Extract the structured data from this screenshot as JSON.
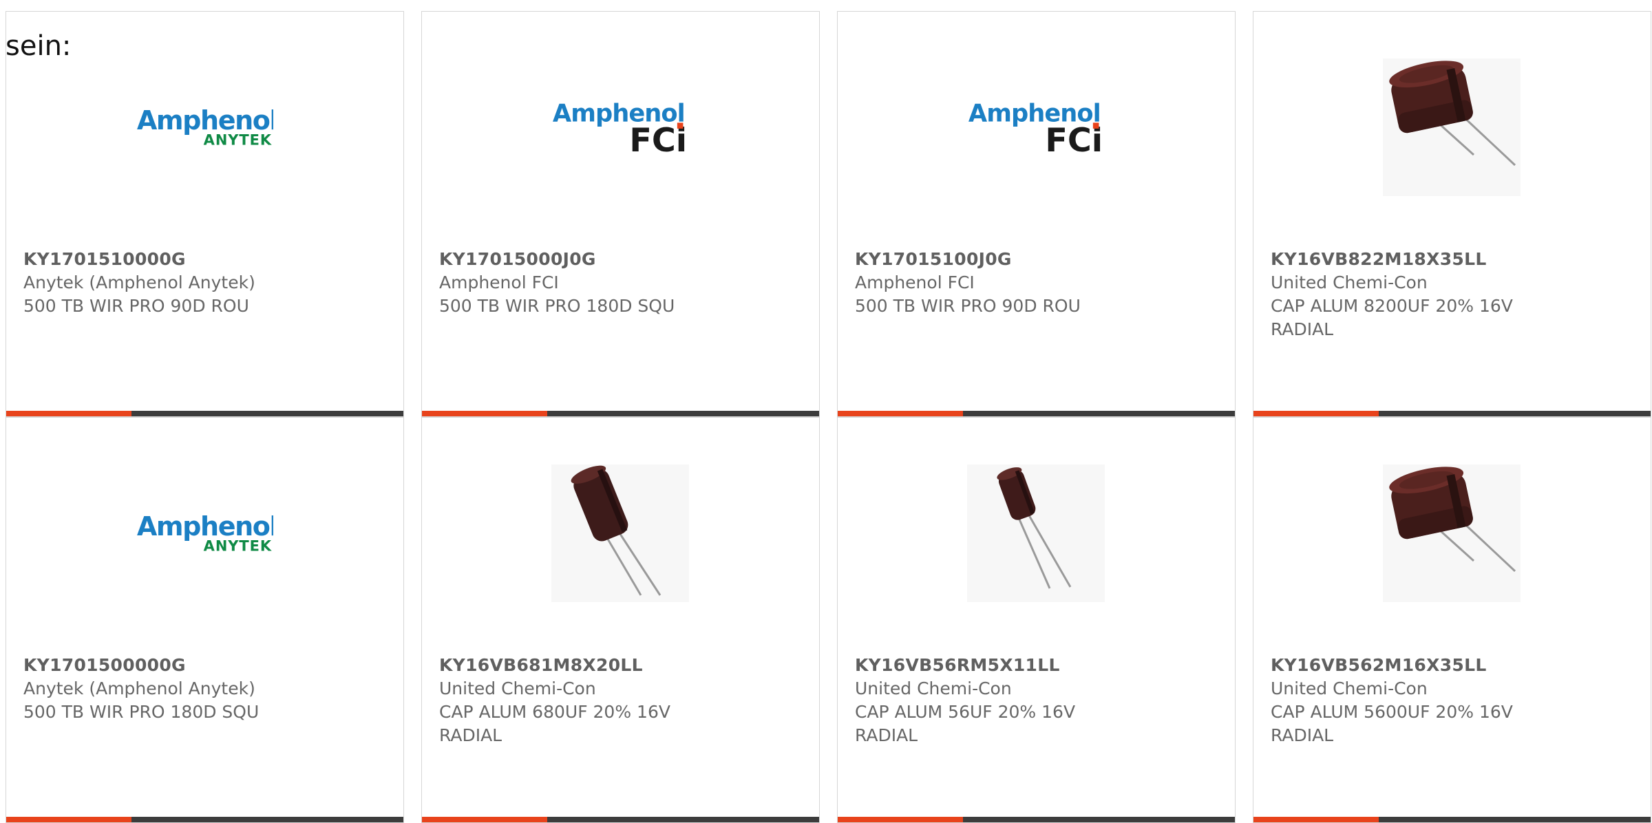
{
  "intro_text": "sein:",
  "accent_color": "#e8431c",
  "products": [
    {
      "part_number": "KY1701510000G",
      "manufacturer": "Anytek (Amphenol Anytek)",
      "description": "500 TB WIR PRO 90D ROU",
      "image": "amphenol-anytek-logo"
    },
    {
      "part_number": "KY17015000J0G",
      "manufacturer": "Amphenol FCI",
      "description": "500 TB WIR PRO 180D SQU",
      "image": "amphenol-fci-logo"
    },
    {
      "part_number": "KY17015100J0G",
      "manufacturer": "Amphenol FCI",
      "description": "500 TB WIR PRO 90D ROU",
      "image": "amphenol-fci-logo"
    },
    {
      "part_number": "KY16VB822M18X35LL",
      "manufacturer": "United Chemi-Con",
      "description": "CAP ALUM 8200UF 20% 16V RADIAL",
      "image": "capacitor-large-photo"
    },
    {
      "part_number": "KY1701500000G",
      "manufacturer": "Anytek (Amphenol Anytek)",
      "description": "500 TB WIR PRO 180D SQU",
      "image": "amphenol-anytek-logo"
    },
    {
      "part_number": "KY16VB681M8X20LL",
      "manufacturer": "United Chemi-Con",
      "description": "CAP ALUM 680UF 20% 16V RADIAL",
      "image": "capacitor-tall-photo"
    },
    {
      "part_number": "KY16VB56RM5X11LL",
      "manufacturer": "United Chemi-Con",
      "description": "CAP ALUM 56UF 20% 16V RADIAL",
      "image": "capacitor-small-photo"
    },
    {
      "part_number": "KY16VB562M16X35LL",
      "manufacturer": "United Chemi-Con",
      "description": "CAP ALUM 5600UF 20% 16V RADIAL",
      "image": "capacitor-large-photo"
    }
  ],
  "logos": {
    "amphenol_word": "Amphenol",
    "anytek_word": "ANYTEK",
    "fci_word": "FCi",
    "amphenol_color": "#1b7fc4",
    "anytek_color": "#0f8a45",
    "fci_color": "#1a1a1a",
    "fci_dot_color": "#e8431c"
  }
}
